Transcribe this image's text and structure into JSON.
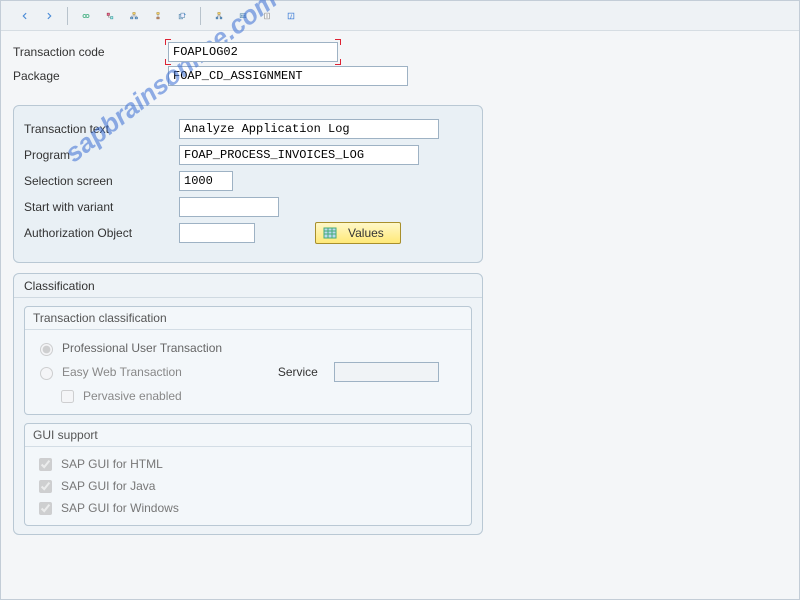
{
  "watermark": "sapbrainsonline.com",
  "header": {
    "tcode_label": "Transaction code",
    "tcode_value": "FOAPLOG02",
    "package_label": "Package",
    "package_value": "FOAP_CD_ASSIGNMENT"
  },
  "details": {
    "trans_text_label": "Transaction text",
    "trans_text_value": "Analyze Application Log",
    "program_label": "Program",
    "program_value": "FOAP_PROCESS_INVOICES_LOG",
    "sel_label": "Selection screen",
    "sel_value": "1000",
    "variant_label": "Start with variant",
    "variant_value": "",
    "auth_label": "Authorization Object",
    "auth_value": "",
    "values_button": "Values"
  },
  "classification": {
    "panel_title": "Classification",
    "trans_class_title": "Transaction classification",
    "prof_user": "Professional User Transaction",
    "easy_web": "Easy Web Transaction",
    "service_label": "Service",
    "service_value": "",
    "pervasive": "Pervasive enabled",
    "gui_title": "GUI support",
    "gui_html": "SAP GUI for HTML",
    "gui_java": "SAP GUI for Java",
    "gui_win": "SAP GUI for Windows"
  },
  "toolbar_icons": {
    "back": "back-icon",
    "forward": "forward-icon",
    "glasses": "display-icon",
    "hierarchy1": "tree1-icon",
    "hierarchy2": "tree2-icon",
    "hierarchy3": "tree3-icon",
    "copy": "copy-icon",
    "org1": "org1-icon",
    "org2": "org2-icon",
    "doc": "doc-icon",
    "info": "info-icon"
  }
}
